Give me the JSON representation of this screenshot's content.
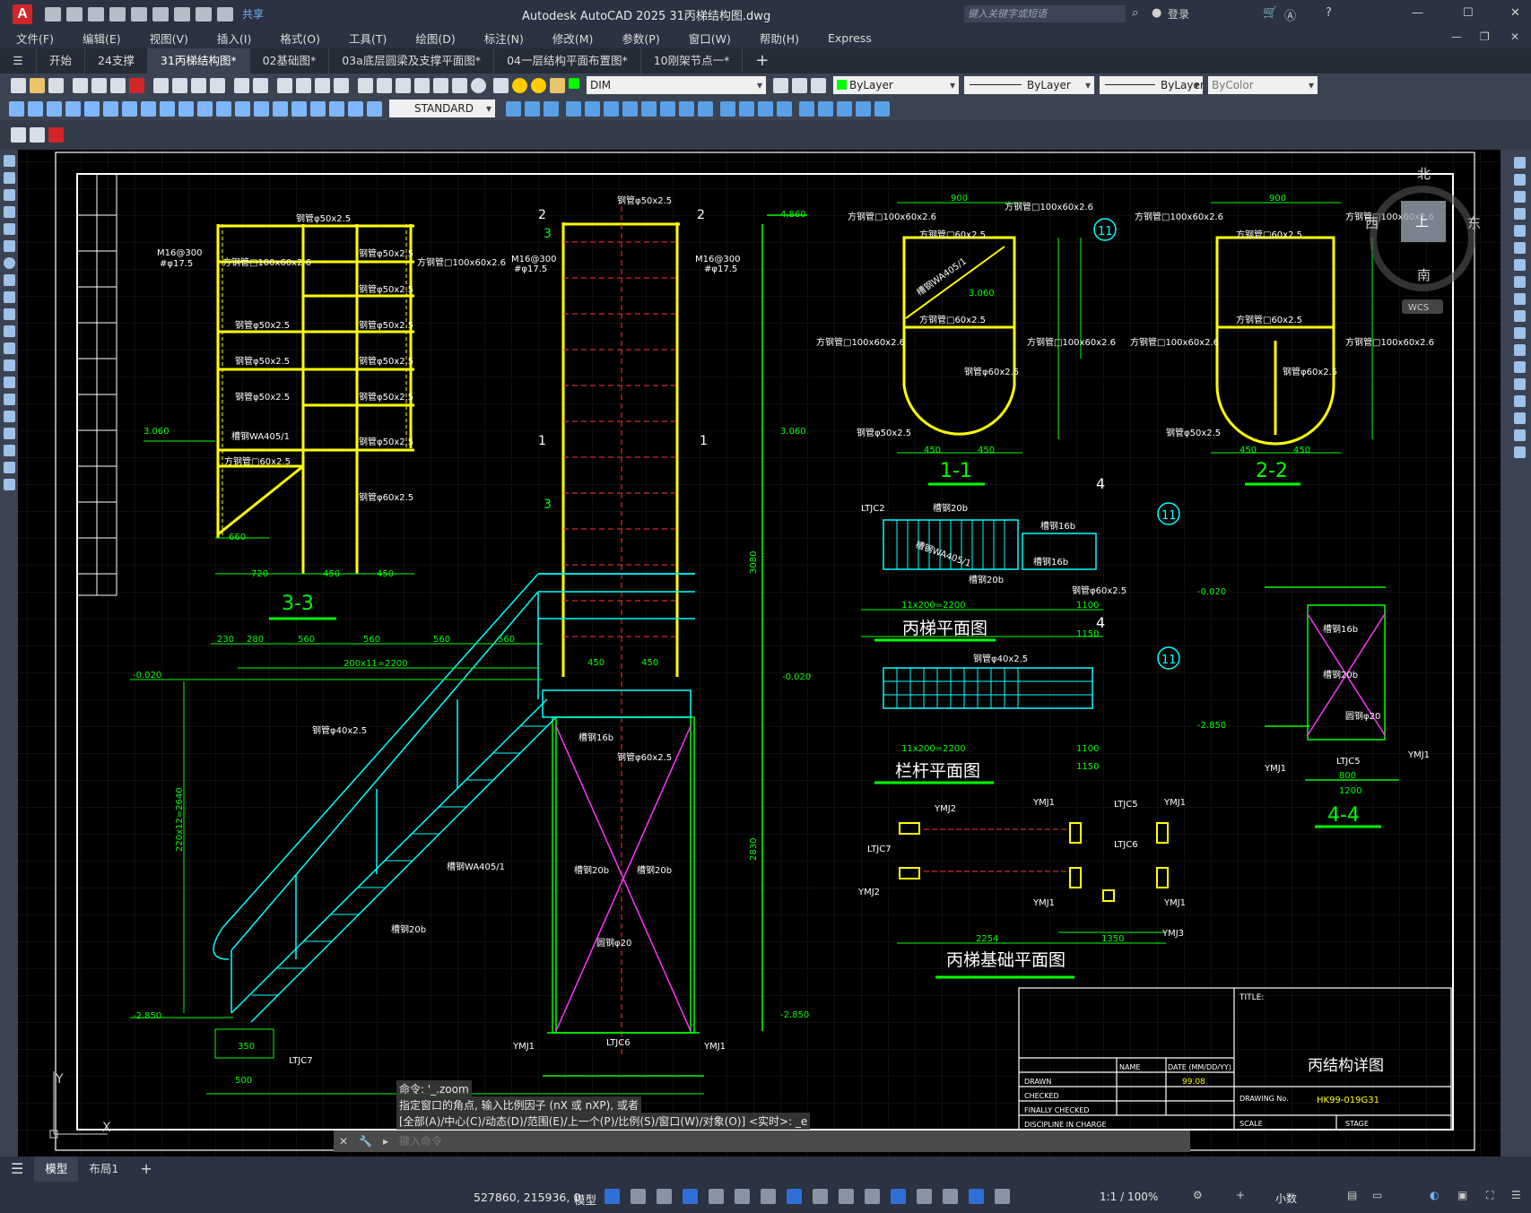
{
  "titlebar": {
    "logo": "A",
    "share_label": "共享",
    "window_title": "Autodesk AutoCAD 2025    31丙梯结构图.dwg",
    "search_placeholder": "键入关键字或短语",
    "login_label": "登录"
  },
  "menubar": {
    "items": [
      "文件(F)",
      "编辑(E)",
      "视图(V)",
      "插入(I)",
      "格式(O)",
      "工具(T)",
      "绘图(D)",
      "标注(N)",
      "修改(M)",
      "参数(P)",
      "窗口(W)",
      "帮助(H)",
      "Express"
    ]
  },
  "tabs": {
    "items": [
      "开始",
      "24支撑",
      "31丙梯结构图*",
      "02基础图*",
      "03a底层圆梁及支撑平面图*",
      "04一层结构平面布置图*",
      "10刚架节点一*"
    ],
    "active_index": 2,
    "add_label": "+"
  },
  "toolbar": {
    "dimstyle": "DIM",
    "layer_color": "ByLayer",
    "linetype": "ByLayer",
    "lineweight": "ByLayer",
    "plotstyle": "ByColor",
    "textstyle": "STANDARD"
  },
  "viewcube": {
    "north": "北",
    "south": "南",
    "east": "东",
    "west": "西",
    "top": "上",
    "wcs": "WCS"
  },
  "drawing": {
    "section_3_3": "3-3",
    "section_1_1": "1-1",
    "section_2_2": "2-2",
    "section_4_4": "4-4",
    "stair_plan": "丙梯平面图",
    "railing_plan": "栏杆平面图",
    "foundation_plan": "丙梯基础平面图",
    "drawing_title": "丙结构详图",
    "drawing_no": "HK99-019G31",
    "date": "99.08",
    "tb_title": "TITLE:",
    "tb_name": "NAME",
    "tb_date": "DATE (MM/DD/YY)",
    "tb_drawn": "DRAWN",
    "tb_checked": "CHECKED",
    "tb_final": "FINALLY CHECKED",
    "tb_discipline": "DISCIPLINE IN CHARGE",
    "tb_drawingno": "DRAWING No.",
    "tb_scale": "SCALE",
    "tb_stage": "STAGE",
    "levels": [
      "4.860",
      "3.060",
      "3.060",
      "-0.020",
      "-0.020",
      "-2.850",
      "-2.850",
      "-0.020",
      "-2.850"
    ],
    "ucs_y": "Y",
    "ucs_x": "X"
  },
  "command": {
    "line1": "命令: '_.zoom",
    "line2": "指定窗口的角点, 输入比例因子 (nX 或 nXP), 或者",
    "line3": "[全部(A)/中心(C)/动态(D)/范围(E)/上一个(P)/比例(S)/窗口(W)/对象(O)] <实时>: _e",
    "placeholder": "键入命令"
  },
  "layout_tabs": {
    "items": [
      "模型",
      "布局1"
    ],
    "active_index": 0
  },
  "status": {
    "coords": "527860, 215936, 0",
    "model": "模型",
    "scale": "1:1 / 100%",
    "units": "小数"
  }
}
